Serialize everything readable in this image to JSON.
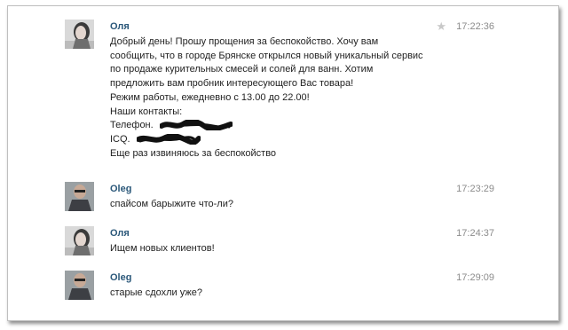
{
  "messages": [
    {
      "author": "Оля",
      "time": "17:22:36",
      "avatar": "girl-avatar",
      "lines": [
        "Добрый день! Прошу прощения за беспокойство. Хочу вам",
        "сообщить, что в городе Брянске открылся новый уникальный сервис",
        "по продаже курительных смесей и солей для ванн. Хотим",
        "предложить вам пробник интересующего Вас товара!",
        "Режим работы, ежедневно с 13.00 до 22.00!",
        "Наши контакты:",
        "Телефон.",
        "ICQ.",
        "Еще раз извиняюсь за беспокойство"
      ]
    },
    {
      "author": "Oleg",
      "time": "17:23:29",
      "avatar": "guy-avatar",
      "lines": [
        "спайсом барыжите что-ли?"
      ]
    },
    {
      "author": "Оля",
      "time": "17:24:37",
      "avatar": "girl-avatar",
      "lines": [
        "Ищем новых клиентов!"
      ]
    },
    {
      "author": "Oleg",
      "time": "17:29:09",
      "avatar": "guy-avatar",
      "lines": [
        "старые сдохли уже?"
      ]
    }
  ],
  "colors": {
    "author": "#2b587a",
    "time": "#8c8c8c",
    "text": "#1f1f1f"
  }
}
